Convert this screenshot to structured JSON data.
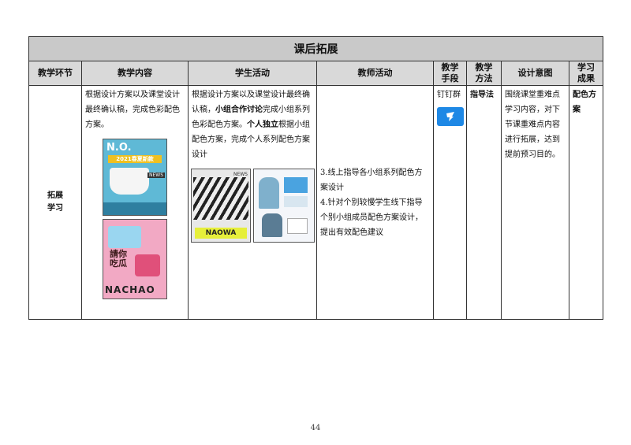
{
  "table": {
    "title": "课后拓展",
    "headers": [
      "教学环节",
      "教学内容",
      "学生活动",
      "教师活动",
      "教学\n手段",
      "教学\n方法",
      "设计意图",
      "学习\n成果"
    ],
    "stage": "拓展\n学习",
    "content_text": "根据设计方案以及课堂设计最终确认稿，完成色彩配色方案。",
    "student_text_1": "根据设计方案以及课堂设计最终确认稿，",
    "student_bold_1": "小组合作讨论",
    "student_text_2": "完成小组系列色彩配色方案。",
    "student_bold_2": "个人独立",
    "student_text_3": "根据小组配色方案，完成个人系列配色方案设计",
    "teacher_text": "3.线上指导各小组系列配色方案设计\n4.针对个别较慢学生线下指导个别小组成员配色方案设计，提出有效配色建议",
    "means": "钉钉群",
    "method": "指导法",
    "intent": "围绕课堂重难点学习内容，对下节课重难点内容进行拓展，达到提前预习目的。",
    "outcome": "配色方案"
  },
  "posters": {
    "p1_brand": "N.O.",
    "p1_caption": "2021春夏新款",
    "p1_tag": "NEWS",
    "p2_top": "請你吃瓜",
    "p2_bottom": "NACHAO",
    "p3_tag": "NEWS",
    "p3_bottom": "NAOWA"
  },
  "page_number": "44",
  "colors": {
    "title_bg": "#c9c9c9",
    "header_bg": "#d9d9d9",
    "dingtalk": "#1e88e5"
  }
}
